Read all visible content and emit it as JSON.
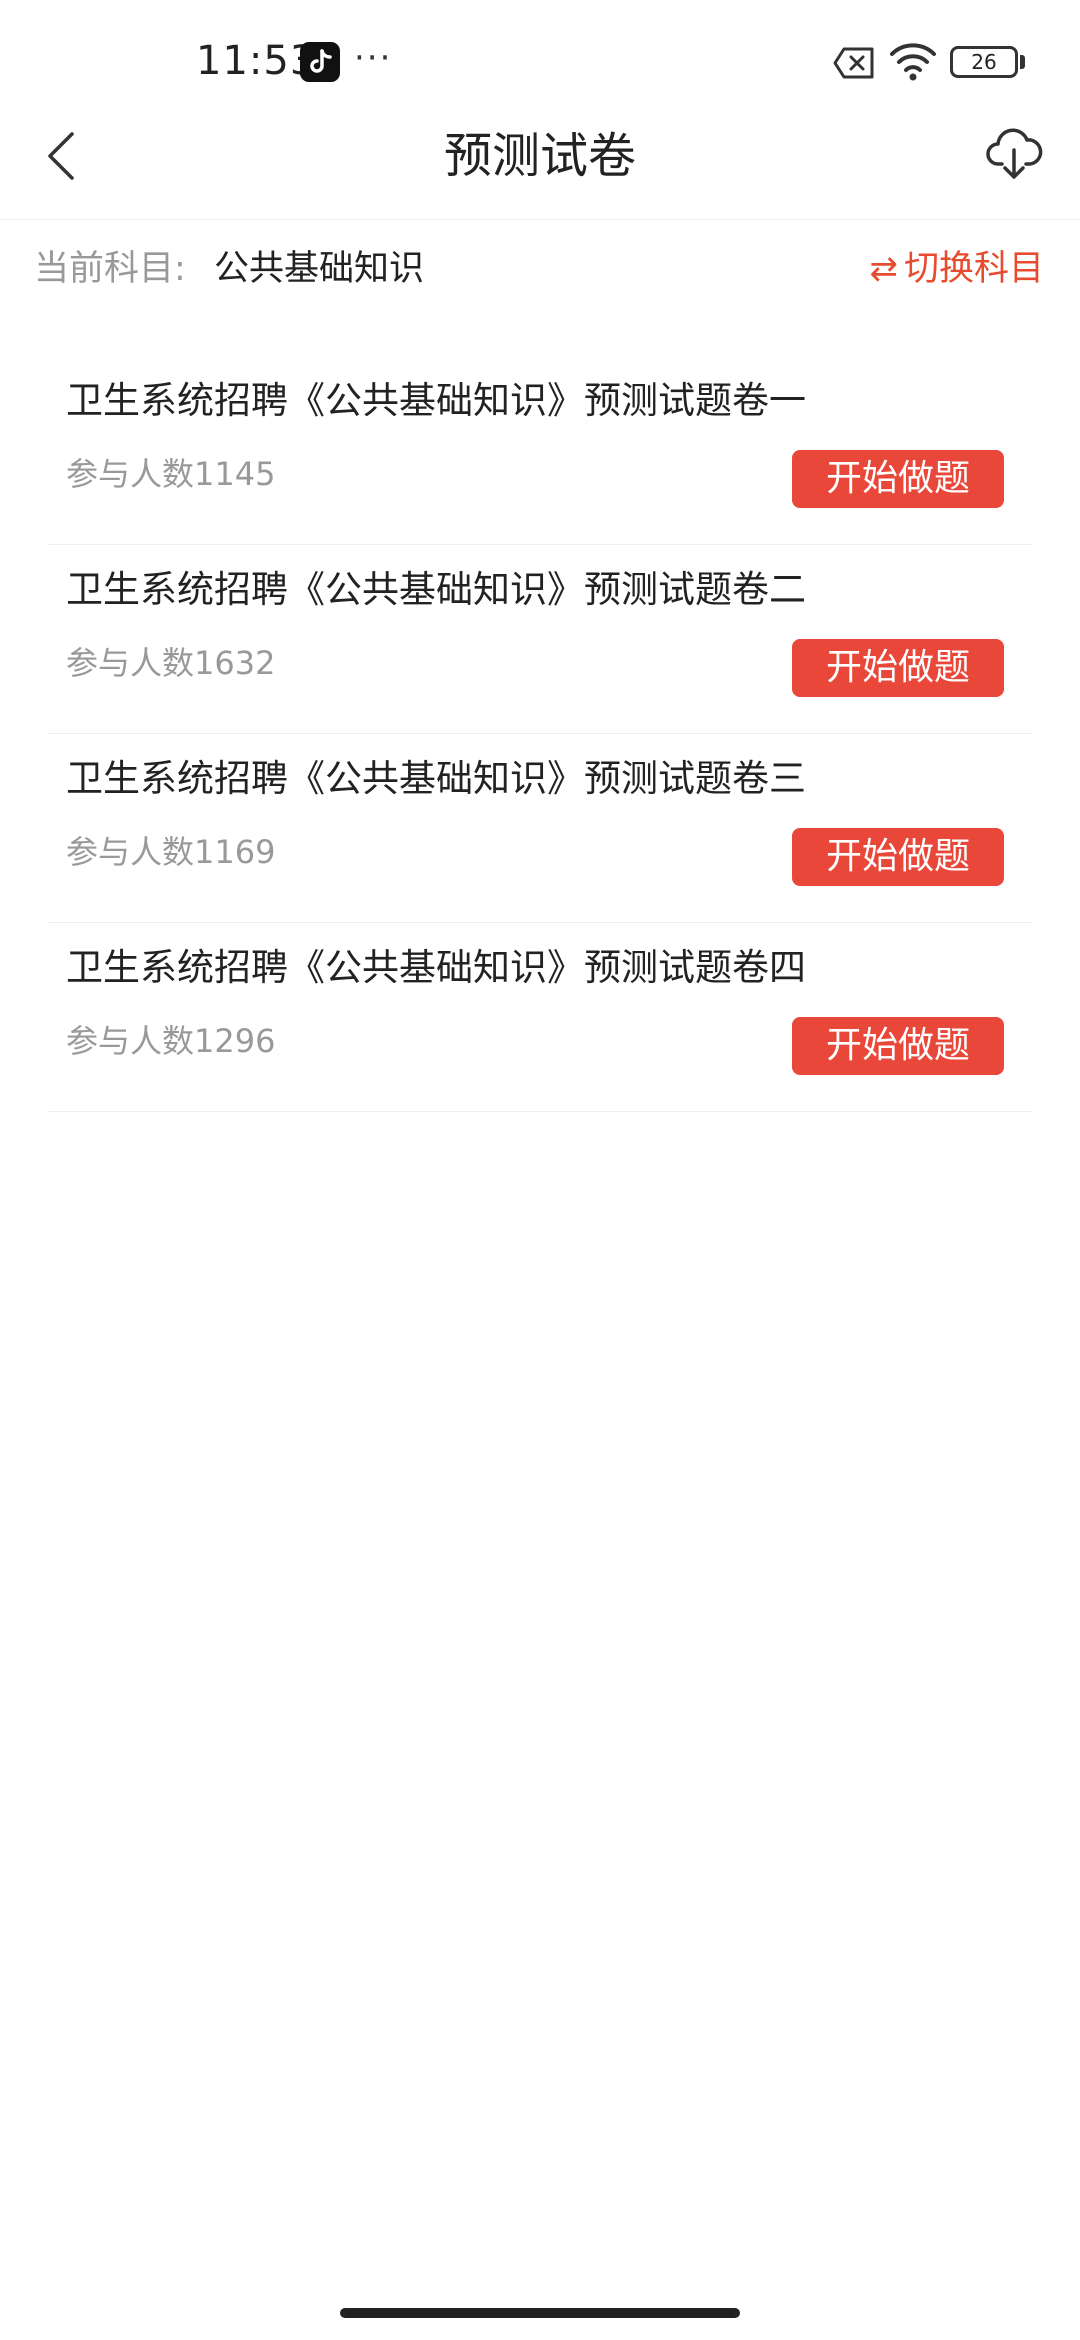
{
  "status_bar": {
    "time": "11:53",
    "more": "···",
    "battery": "26"
  },
  "header": {
    "title": "预测试卷"
  },
  "subject": {
    "label": "当前科目:",
    "value": "公共基础知识",
    "switch_icon": "⇄",
    "switch_label": "切换科目"
  },
  "exams": [
    {
      "title": "卫生系统招聘《公共基础知识》预测试题卷一",
      "participants": "参与人数1145",
      "button": "开始做题"
    },
    {
      "title": "卫生系统招聘《公共基础知识》预测试题卷二",
      "participants": "参与人数1632",
      "button": "开始做题"
    },
    {
      "title": "卫生系统招聘《公共基础知识》预测试题卷三",
      "participants": "参与人数1169",
      "button": "开始做题"
    },
    {
      "title": "卫生系统招聘《公共基础知识》预测试题卷四",
      "participants": "参与人数1296",
      "button": "开始做题"
    }
  ],
  "colors": {
    "accent": "#e8473a",
    "muted_text": "#999999",
    "primary_text": "#222222"
  },
  "icons": [
    "back-arrow-icon",
    "cloud-download-icon",
    "switch-arrows-icon",
    "tiktok-icon",
    "wifi-icon",
    "sim-icon",
    "battery-icon"
  ]
}
